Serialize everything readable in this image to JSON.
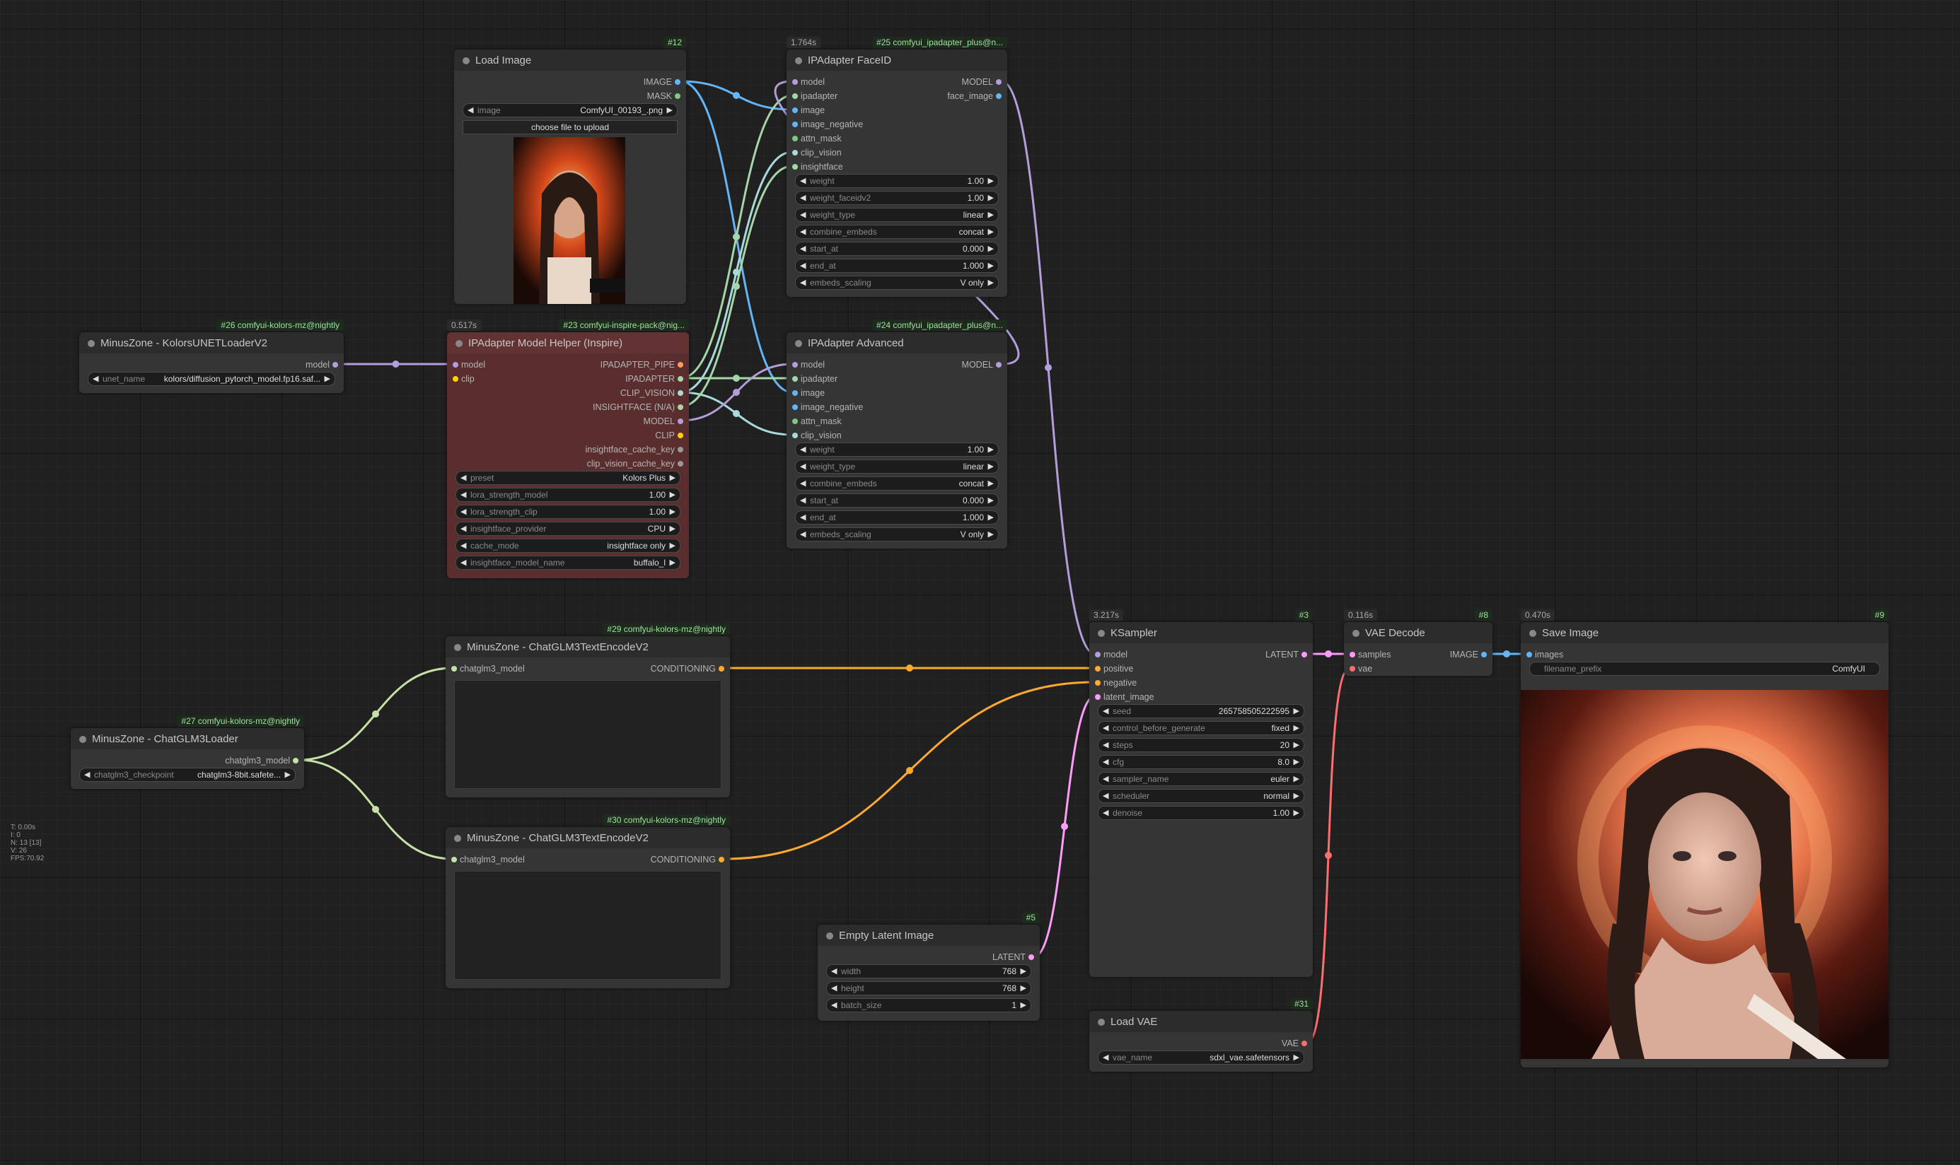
{
  "nodes": {
    "load_image": {
      "title": "Load Image",
      "id": "#12",
      "out_image": "IMAGE",
      "out_mask": "MASK",
      "image_label": "image",
      "image_value": "ComfyUI_00193_.png",
      "upload_label": "choose file to upload"
    },
    "faceid": {
      "title": "IPAdapter FaceID",
      "id": "#25 comfyui_ipadapter_plus@n...",
      "time": "1.764s",
      "inputs": [
        "model",
        "ipadapter",
        "image",
        "image_negative",
        "attn_mask",
        "clip_vision",
        "insightface"
      ],
      "out_model": "MODEL",
      "out_face_image": "face_image",
      "widgets": [
        {
          "label": "weight",
          "value": "1.00"
        },
        {
          "label": "weight_faceidv2",
          "value": "1.00"
        },
        {
          "label": "weight_type",
          "value": "linear"
        },
        {
          "label": "combine_embeds",
          "value": "concat"
        },
        {
          "label": "start_at",
          "value": "0.000"
        },
        {
          "label": "end_at",
          "value": "1.000"
        },
        {
          "label": "embeds_scaling",
          "value": "V only"
        }
      ]
    },
    "kolors_unet": {
      "title": "MinusZone - KolorsUNETLoaderV2",
      "id": "#26 comfyui-kolors-mz@nightly",
      "out_model": "model",
      "w_label": "unet_name",
      "w_value": "kolors/diffusion_pytorch_model.fp16.saf..."
    },
    "model_helper": {
      "title": "IPAdapter Model Helper (Inspire)",
      "id": "#23 comfyui-inspire-pack@nig...",
      "time": "0.517s",
      "inputs": [
        "model",
        "clip"
      ],
      "outputs": [
        "IPADAPTER_PIPE",
        "IPADAPTER",
        "CLIP_VISION",
        "INSIGHTFACE (N/A)",
        "MODEL",
        "CLIP",
        "insightface_cache_key",
        "clip_vision_cache_key"
      ],
      "widgets": [
        {
          "label": "preset",
          "value": "Kolors Plus"
        },
        {
          "label": "lora_strength_model",
          "value": "1.00"
        },
        {
          "label": "lora_strength_clip",
          "value": "1.00"
        },
        {
          "label": "insightface_provider",
          "value": "CPU"
        },
        {
          "label": "cache_mode",
          "value": "insightface only"
        },
        {
          "label": "insightface_model_name",
          "value": "buffalo_l"
        }
      ]
    },
    "ipa_advanced": {
      "title": "IPAdapter Advanced",
      "id": "#24 comfyui_ipadapter_plus@n...",
      "inputs": [
        "model",
        "ipadapter",
        "image",
        "image_negative",
        "attn_mask",
        "clip_vision"
      ],
      "out_model": "MODEL",
      "widgets": [
        {
          "label": "weight",
          "value": "1.00"
        },
        {
          "label": "weight_type",
          "value": "linear"
        },
        {
          "label": "combine_embeds",
          "value": "concat"
        },
        {
          "label": "start_at",
          "value": "0.000"
        },
        {
          "label": "end_at",
          "value": "1.000"
        },
        {
          "label": "embeds_scaling",
          "value": "V only"
        }
      ]
    },
    "ksampler": {
      "title": "KSampler",
      "id": "#3",
      "time": "3.217s",
      "inputs": [
        "model",
        "positive",
        "negative",
        "latent_image"
      ],
      "out_latent": "LATENT",
      "widgets": [
        {
          "label": "seed",
          "value": "265758505222595"
        },
        {
          "label": "control_before_generate",
          "value": "fixed"
        },
        {
          "label": "steps",
          "value": "20"
        },
        {
          "label": "cfg",
          "value": "8.0"
        },
        {
          "label": "sampler_name",
          "value": "euler"
        },
        {
          "label": "scheduler",
          "value": "normal"
        },
        {
          "label": "denoise",
          "value": "1.00"
        }
      ]
    },
    "vae_decode": {
      "title": "VAE Decode",
      "id": "#8",
      "time": "0.116s",
      "in_samples": "samples",
      "in_vae": "vae",
      "out_image": "IMAGE"
    },
    "save_image": {
      "title": "Save Image",
      "id": "#9",
      "time": "0.470s",
      "in_images": "images",
      "w_label": "filename_prefix",
      "w_value": "ComfyUI"
    },
    "encode1": {
      "title": "MinusZone - ChatGLM3TextEncodeV2",
      "id": "#29 comfyui-kolors-mz@nightly",
      "in": "chatglm3_model",
      "out": "CONDITIONING"
    },
    "encode2": {
      "title": "MinusZone - ChatGLM3TextEncodeV2",
      "id": "#30 comfyui-kolors-mz@nightly",
      "in": "chatglm3_model",
      "out": "CONDITIONING"
    },
    "glm_loader": {
      "title": "MinusZone - ChatGLM3Loader",
      "id": "#27 comfyui-kolors-mz@nightly",
      "out": "chatglm3_model",
      "w_label": "chatglm3_checkpoint",
      "w_value": "chatglm3-8bit.safete..."
    },
    "empty_latent": {
      "title": "Empty Latent Image",
      "id": "#5",
      "out": "LATENT",
      "widgets": [
        {
          "label": "width",
          "value": "768"
        },
        {
          "label": "height",
          "value": "768"
        },
        {
          "label": "batch_size",
          "value": "1"
        }
      ]
    },
    "load_vae": {
      "title": "Load VAE",
      "id": "#31",
      "out": "VAE",
      "w_label": "vae_name",
      "w_value": "sdxl_vae.safetensors"
    }
  },
  "stats": [
    "T: 0.00s",
    "I: 0",
    "N: 13 [13]",
    "V: 26",
    "FPS:70.92"
  ],
  "colors": {
    "model": "#b39ddb",
    "clip": "#ffd500",
    "image": "#64b5f6",
    "conditioning": "#ffa931",
    "latent": "#ff9cf9",
    "vae": "#ff6e6e",
    "ipadapter": "#a5d6a7",
    "clip_vision": "#a8dadc",
    "mask": "#81c784",
    "glm": "#c5e1a5"
  }
}
